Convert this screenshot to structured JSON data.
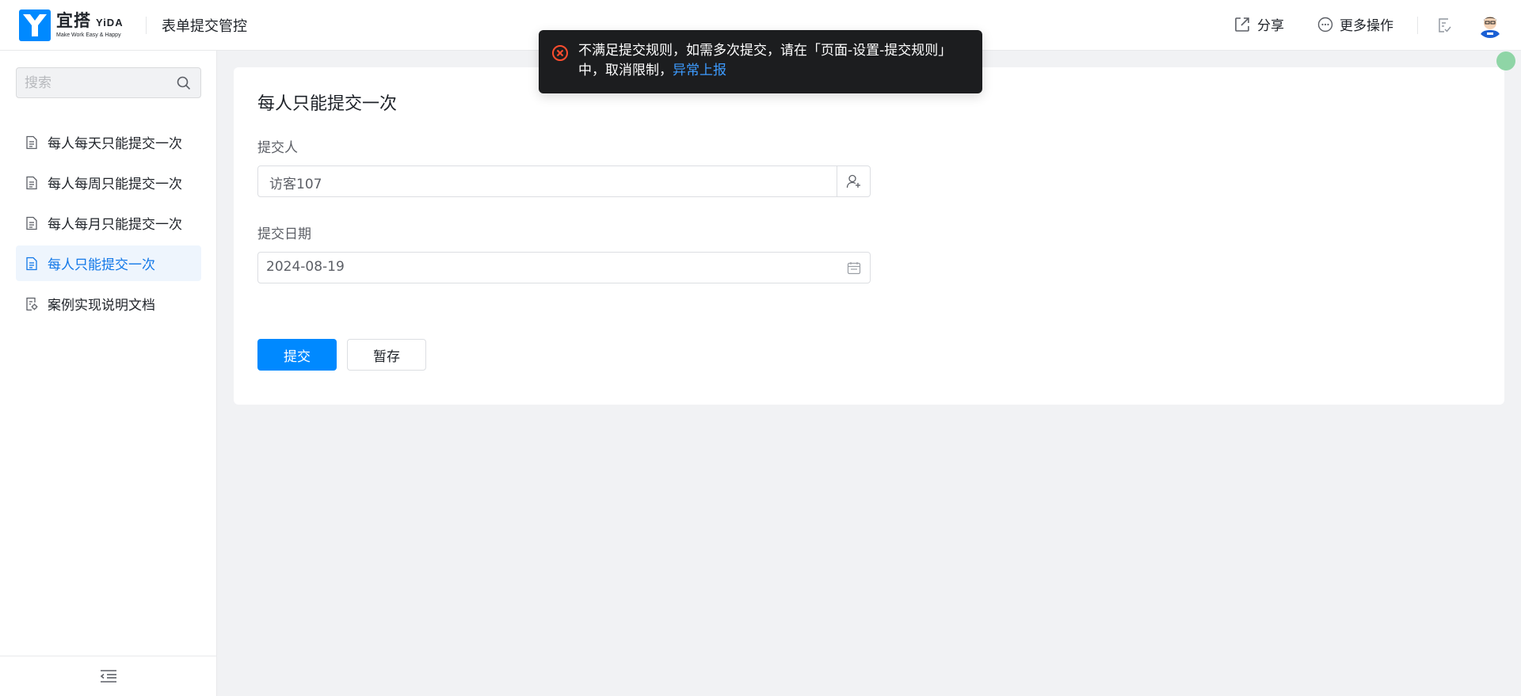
{
  "header": {
    "logo_cn": "宜搭",
    "logo_en": "YiDA",
    "logo_slogan": "Make Work Easy & Happy",
    "app_title": "表单提交管控",
    "share_label": "分享",
    "more_label": "更多操作"
  },
  "sidebar": {
    "search_placeholder": "搜索",
    "items": [
      {
        "label": "每人每天只能提交一次",
        "icon": "form-page-icon",
        "active": false
      },
      {
        "label": "每人每周只能提交一次",
        "icon": "form-page-icon",
        "active": false
      },
      {
        "label": "每人每月只能提交一次",
        "icon": "form-page-icon",
        "active": false
      },
      {
        "label": "每人只能提交一次",
        "icon": "form-page-icon",
        "active": true
      },
      {
        "label": "案例实现说明文档",
        "icon": "custom-page-icon",
        "active": false
      }
    ]
  },
  "form": {
    "title": "每人只能提交一次",
    "submitter_label": "提交人",
    "submitter_value": "访客107",
    "date_label": "提交日期",
    "date_value": "2024-08-19",
    "submit_label": "提交",
    "save_draft_label": "暂存"
  },
  "toast": {
    "message": "不满足提交规则，如需多次提交，请在「页面-设置-提交规则」中，取消限制，",
    "link_label": "异常上报",
    "type": "error"
  },
  "colors": {
    "brand": "#0089ff",
    "active_nav_bg": "#eef5fd",
    "active_nav_text": "#1278e8",
    "toast_bg": "#1c1d1f",
    "error": "#ff4d2e",
    "link": "#3d9bff"
  }
}
